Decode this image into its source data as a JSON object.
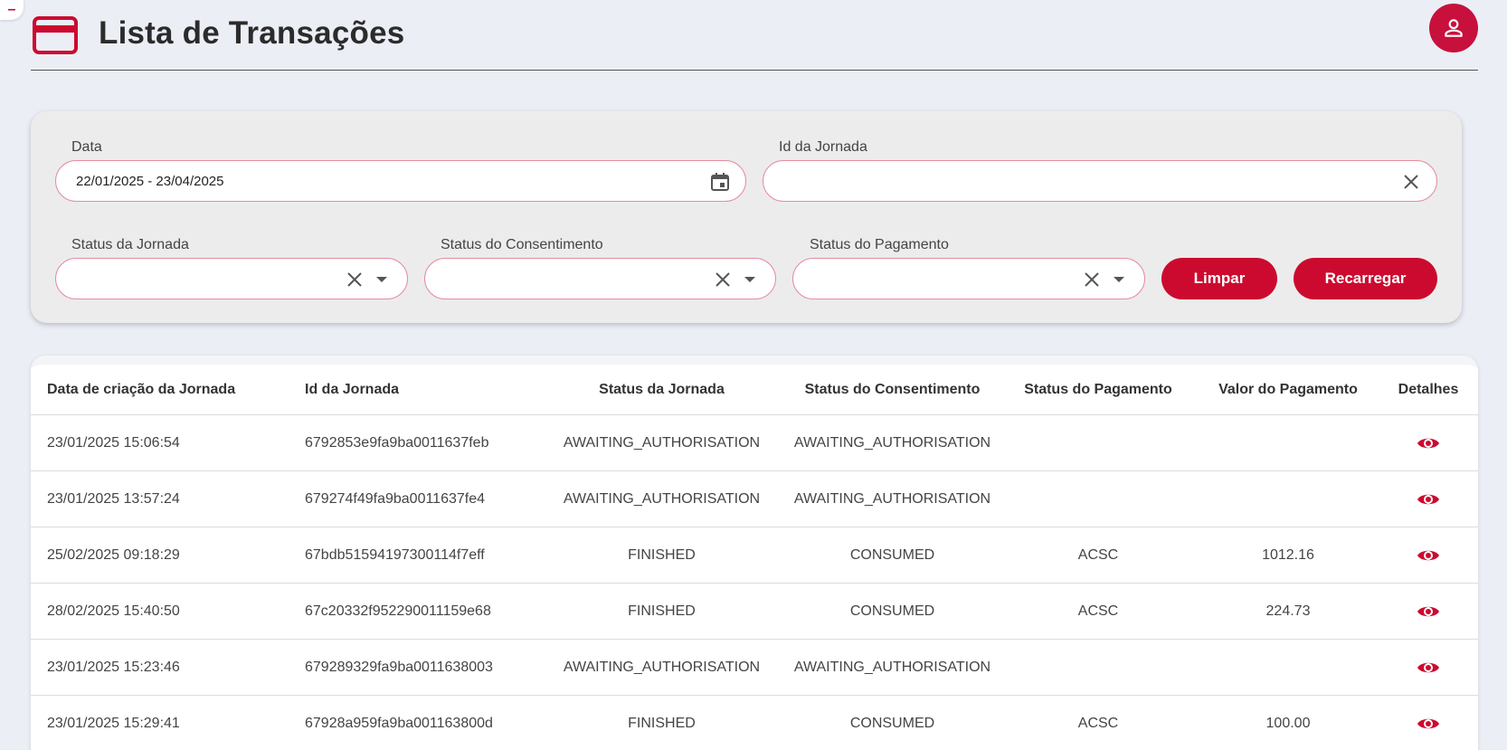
{
  "colors": {
    "accent": "#cc0a2f",
    "background": "#eceef6",
    "panel": "#ececec"
  },
  "corner_tab": {
    "label": "–"
  },
  "header": {
    "title": "Lista de Transações",
    "icon": "credit-card-icon",
    "avatar_icon": "person-icon"
  },
  "filters": {
    "date": {
      "label": "Data",
      "value": "22/01/2025 - 23/04/2025",
      "icon": "calendar-icon"
    },
    "journey_id": {
      "label": "Id da Jornada",
      "value": "",
      "icon": "close-icon"
    },
    "journey_status": {
      "label": "Status da Jornada",
      "value": ""
    },
    "consent_status": {
      "label": "Status do Consentimento",
      "value": ""
    },
    "payment_status": {
      "label": "Status do Pagamento",
      "value": ""
    },
    "clear_button": "Limpar",
    "reload_button": "Recarregar"
  },
  "table": {
    "columns": [
      "Data de criação da Jornada",
      "Id da Jornada",
      "Status da Jornada",
      "Status do Consentimento",
      "Status do Pagamento",
      "Valor do Pagamento",
      "Detalhes"
    ],
    "rows": [
      {
        "created": "23/01/2025 15:06:54",
        "id": "6792853e9fa9ba0011637feb",
        "journey_status": "AWAITING_AUTHORISATION",
        "consent_status": "AWAITING_AUTHORISATION",
        "payment_status": "",
        "amount": ""
      },
      {
        "created": "23/01/2025 13:57:24",
        "id": "679274f49fa9ba0011637fe4",
        "journey_status": "AWAITING_AUTHORISATION",
        "consent_status": "AWAITING_AUTHORISATION",
        "payment_status": "",
        "amount": ""
      },
      {
        "created": "25/02/2025 09:18:29",
        "id": "67bdb51594197300114f7eff",
        "journey_status": "FINISHED",
        "consent_status": "CONSUMED",
        "payment_status": "ACSC",
        "amount": "1012.16"
      },
      {
        "created": "28/02/2025 15:40:50",
        "id": "67c20332f952290011159e68",
        "journey_status": "FINISHED",
        "consent_status": "CONSUMED",
        "payment_status": "ACSC",
        "amount": "224.73"
      },
      {
        "created": "23/01/2025 15:23:46",
        "id": "679289329fa9ba0011638003",
        "journey_status": "AWAITING_AUTHORISATION",
        "consent_status": "AWAITING_AUTHORISATION",
        "payment_status": "",
        "amount": ""
      },
      {
        "created": "23/01/2025 15:29:41",
        "id": "67928a959fa9ba001163800d",
        "journey_status": "FINISHED",
        "consent_status": "CONSUMED",
        "payment_status": "ACSC",
        "amount": "100.00"
      }
    ],
    "details_icon": "eye-icon"
  }
}
